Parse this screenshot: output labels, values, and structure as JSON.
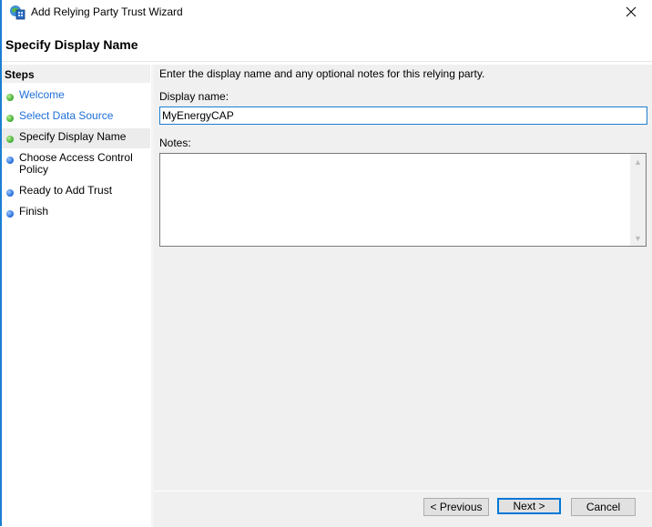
{
  "window": {
    "title": "Add Relying Party Trust Wizard",
    "icon": "relying-party-wizard-icon",
    "close_icon": "close-icon"
  },
  "header": {
    "title": "Specify Display Name"
  },
  "steps": {
    "title": "Steps",
    "items": [
      {
        "label": "Welcome",
        "status": "completed",
        "link": true
      },
      {
        "label": "Select Data Source",
        "status": "completed",
        "link": true
      },
      {
        "label": "Specify Display Name",
        "status": "current",
        "link": false
      },
      {
        "label": "Choose Access Control Policy",
        "status": "pending",
        "link": false
      },
      {
        "label": "Ready to Add Trust",
        "status": "pending",
        "link": false
      },
      {
        "label": "Finish",
        "status": "pending",
        "link": false
      }
    ]
  },
  "main": {
    "instruction": "Enter the display name and any optional notes for this relying party.",
    "display_name_label": "Display name:",
    "display_name_value": "MyEnergyCAP",
    "notes_label": "Notes:",
    "notes_value": ""
  },
  "buttons": {
    "previous": "< Previous",
    "next": "Next >",
    "cancel": "Cancel"
  },
  "colors": {
    "accent": "#1b7fd1",
    "link": "#1e6fd9",
    "completed_dot": "#3aa830",
    "pending_dot": "#1f68d8"
  }
}
